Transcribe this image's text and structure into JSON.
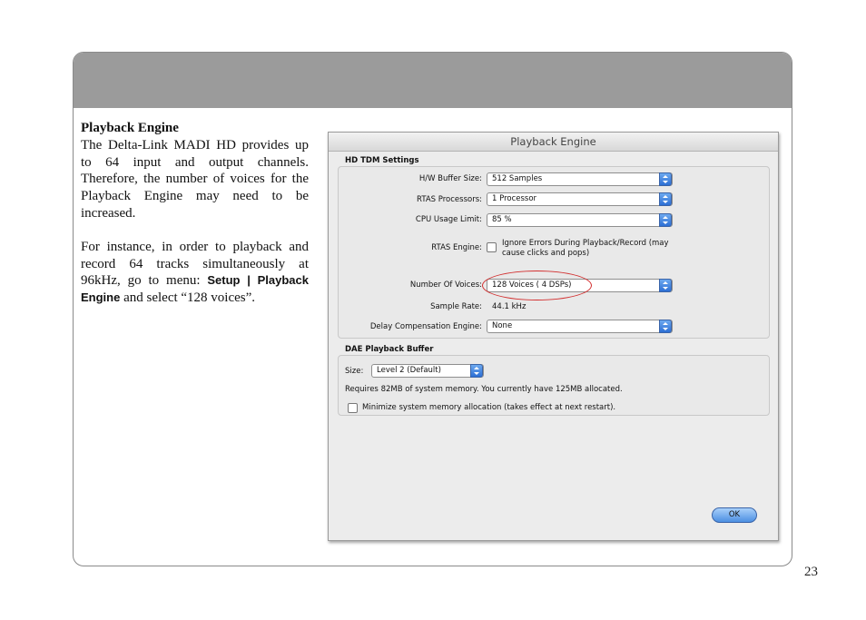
{
  "page": {
    "number": "23"
  },
  "text": {
    "title": "Playback Engine",
    "para1": "The Delta-Link MADI HD provides up to 64 input and output channels. Therefore, the number of voices for the Playback Engine may need to be increased.",
    "para2_before": "For instance, in order to playback and record 64 tracks simultaneously at 96kHz, go to menu: ",
    "para2_menu": "Setup | Playback Engine",
    "para2_after": " and select “128 voices”."
  },
  "dialog": {
    "title": "Playback Engine",
    "hd_group_label": "HD TDM Settings",
    "hw_buffer": {
      "label": "H/W Buffer Size:",
      "value": "512 Samples"
    },
    "rtas_processors": {
      "label": "RTAS Processors:",
      "value": "1 Processor"
    },
    "cpu_limit": {
      "label": "CPU Usage Limit:",
      "value": "85 %"
    },
    "rtas_engine": {
      "label": "RTAS Engine:",
      "option_line1": "Ignore Errors During Playback/Record (may",
      "option_line2": "cause clicks and pops)",
      "checked": false
    },
    "voices": {
      "label": "Number Of Voices:",
      "value": "128 Voices ( 4 DSPs)"
    },
    "sample_rate": {
      "label": "Sample Rate:",
      "value": "44.1 kHz"
    },
    "delay_comp": {
      "label": "Delay Compensation Engine:",
      "value": "None"
    },
    "dae_group_label": "DAE Playback Buffer",
    "size": {
      "label": "Size:",
      "value": "Level 2 (Default)"
    },
    "memory_note": "Requires 82MB of system memory. You currently have 125MB allocated.",
    "minimize": {
      "label": "Minimize system memory allocation (takes effect at next restart).",
      "checked": false
    },
    "ok_label": "OK"
  },
  "colors": {
    "header_band": "#9b9b9b",
    "highlight": "#d23030",
    "accent": "#2d6fd4"
  }
}
